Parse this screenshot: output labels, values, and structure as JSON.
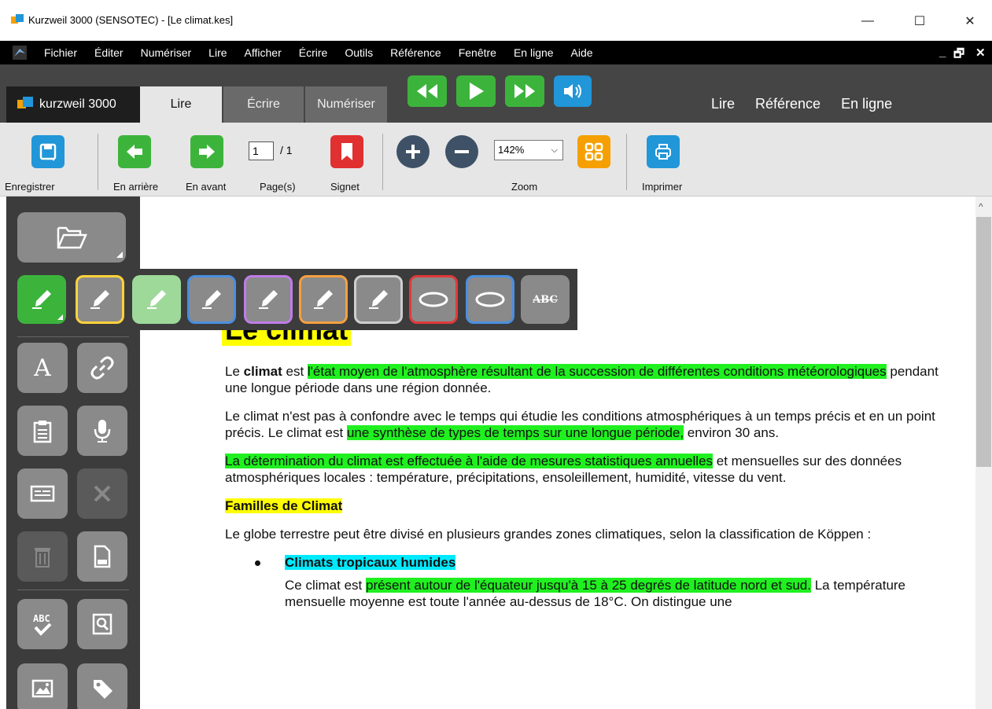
{
  "window": {
    "title": "Kurzweil 3000 (SENSOTEC) - [Le climat.kes]",
    "minimize": "—",
    "maximize": "☐",
    "close": "✕"
  },
  "menu": {
    "items": [
      "Fichier",
      "Éditer",
      "Numériser",
      "Lire",
      "Afficher",
      "Écrire",
      "Outils",
      "Référence",
      "Fenêtre",
      "En ligne",
      "Aide"
    ],
    "mdi_min": "_",
    "mdi_restore": "🗗",
    "mdi_close": "✕"
  },
  "ribbon": {
    "brand": "kurzweil 3000",
    "tabs": [
      "Lire",
      "Écrire",
      "Numériser"
    ],
    "right_nav": [
      "Lire",
      "Référence",
      "En ligne"
    ]
  },
  "toolbar": {
    "save_label": "Enregistrer",
    "back_label": "En arrière",
    "forward_label": "En avant",
    "page_value": "1",
    "page_total": "/ 1",
    "pages_label": "Page(s)",
    "bookmark_label": "Signet",
    "zoom_value": "142%",
    "zoom_label": "Zoom",
    "print_label": "Imprimer"
  },
  "palette": {
    "strike_label": "ABC"
  },
  "left_panel": {
    "font_glyph": "A"
  },
  "document": {
    "title": "Le climat",
    "p1_a": "Le ",
    "p1_b": "climat",
    "p1_c": " est ",
    "p1_hl": "l'état moyen de l'atmosphère résultant de la succession de différentes conditions météorologiques",
    "p1_d": " pendant une longue période dans une région donnée.",
    "p2_a": "Le climat n'est pas à confondre avec le temps qui étudie les conditions atmosphériques à un temps précis et en un point précis. Le climat est ",
    "p2_hl": "une synthèse de types de temps sur une longue période,",
    "p2_b": " environ 30 ans.",
    "p3_hl": "La détermination du climat est effectuée à l'aide de mesures statistiques annuelles",
    "p3_a": " et mensuelles sur des données atmosphériques locales : température, précipitations, ensoleillement, humidité, vitesse du vent.",
    "h2": "Familles de Climat",
    "p4": "Le globe terrestre peut être divisé en plusieurs grandes zones climatiques, selon la classification de Köppen :",
    "bullet1": "Climats tropicaux humides",
    "p5_a": "Ce climat est ",
    "p5_hl": "présent autour de l'équateur jusqu'à 15 à 25 degrés de latitude nord et sud.",
    "p5_b": " La température mensuelle moyenne est toute l'année au-dessus de 18°C. On distingue une"
  },
  "colors": {
    "green": "#3cb43c",
    "blue": "#2196d8",
    "red": "#e03030",
    "orange": "#f5a000",
    "highlight_green": "#20f020",
    "highlight_yellow": "#ffff00",
    "highlight_cyan": "#00eaff"
  }
}
